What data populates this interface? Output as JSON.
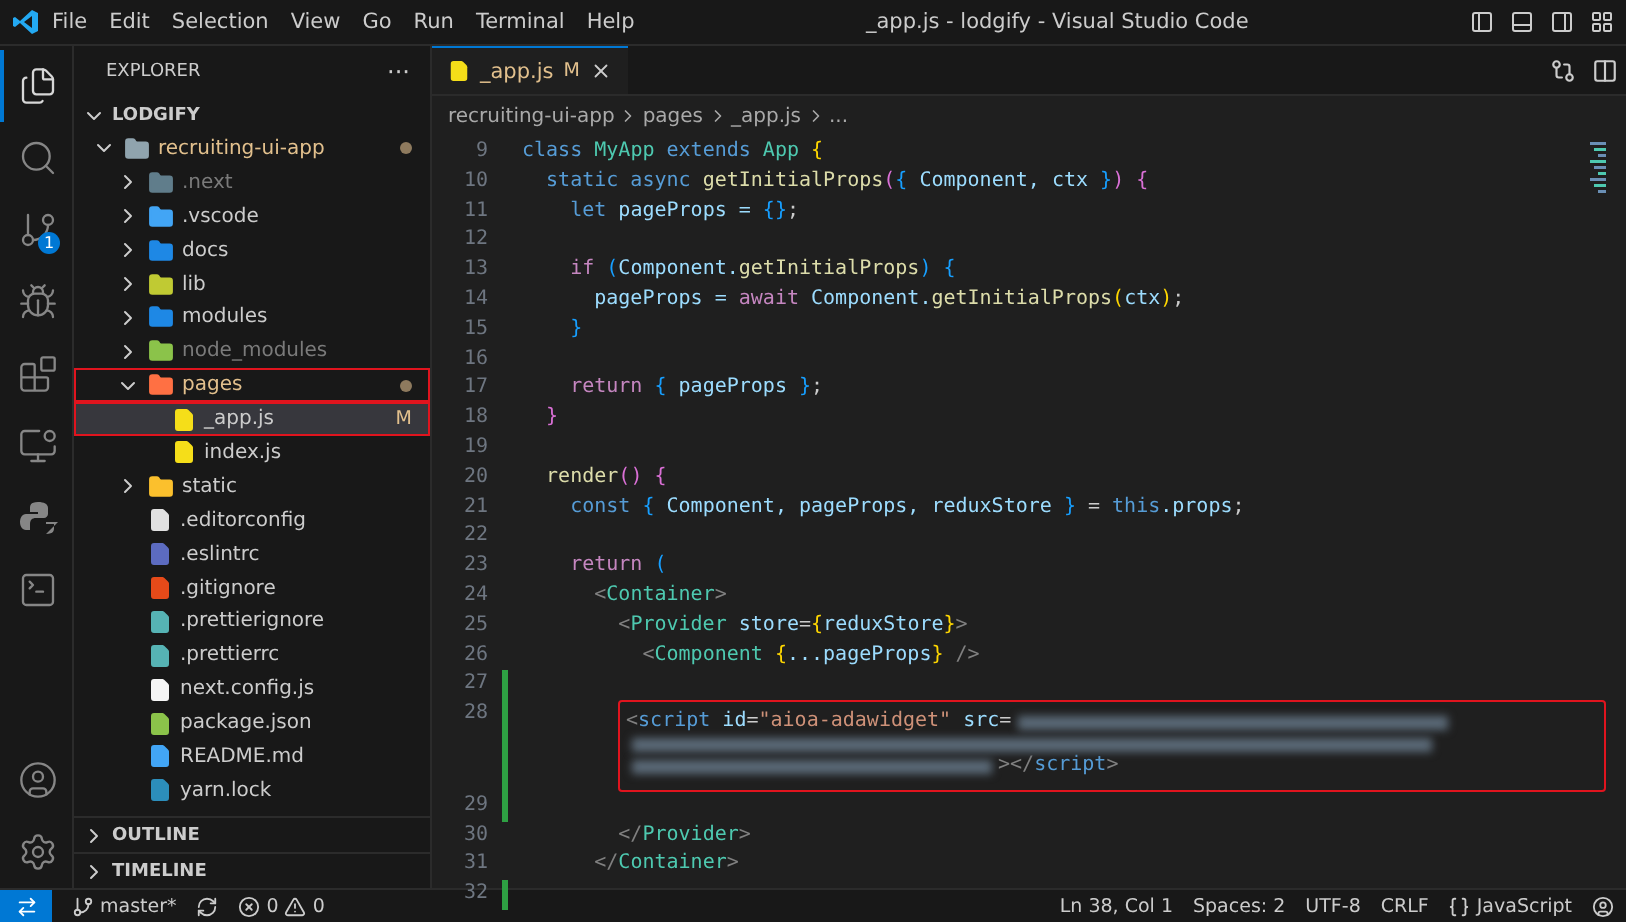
{
  "title_bar": {
    "menu": [
      "File",
      "Edit",
      "Selection",
      "View",
      "Go",
      "Run",
      "Terminal",
      "Help"
    ],
    "title": "_app.js - lodgify - Visual Studio Code"
  },
  "activity_bar": {
    "items": [
      {
        "kind": "files",
        "selected": true
      },
      {
        "kind": "search",
        "selected": false
      },
      {
        "kind": "source-control",
        "selected": false,
        "badge": "1"
      },
      {
        "kind": "debug",
        "selected": false
      },
      {
        "kind": "extensions",
        "selected": false
      },
      {
        "kind": "remote",
        "selected": false
      },
      {
        "kind": "python",
        "selected": false
      },
      {
        "kind": "terminal",
        "selected": false
      }
    ],
    "bottom": [
      {
        "kind": "account"
      },
      {
        "kind": "settings"
      }
    ]
  },
  "sidebar": {
    "title": "EXPLORER",
    "more": "···",
    "workspace": {
      "label": "LODGIFY",
      "expanded": true
    },
    "tree": [
      {
        "label": "recruiting-ui-app",
        "kind": "folder",
        "color": "#90a4ae",
        "expanded": true,
        "modified": true,
        "highlighted": false,
        "selected": false,
        "dimmed": false,
        "children": [
          {
            "label": ".next",
            "kind": "folder",
            "color": "#607d8b",
            "expanded": false,
            "modified": false,
            "highlighted": false,
            "selected": false,
            "dimmed": true
          },
          {
            "label": ".vscode",
            "kind": "folder",
            "color": "#42a5f5",
            "expanded": false,
            "modified": false,
            "highlighted": false,
            "selected": false,
            "dimmed": false
          },
          {
            "label": "docs",
            "kind": "folder",
            "color": "#1e88e5",
            "expanded": false,
            "modified": false,
            "highlighted": false,
            "selected": false,
            "dimmed": false
          },
          {
            "label": "lib",
            "kind": "folder",
            "color": "#c0ca33",
            "expanded": false,
            "modified": false,
            "highlighted": false,
            "selected": false,
            "dimmed": false
          },
          {
            "label": "modules",
            "kind": "folder",
            "color": "#1e88e5",
            "expanded": false,
            "modified": false,
            "highlighted": false,
            "selected": false,
            "dimmed": false
          },
          {
            "label": "node_modules",
            "kind": "folder",
            "color": "#8bc34a",
            "expanded": false,
            "modified": false,
            "highlighted": false,
            "selected": false,
            "dimmed": true
          },
          {
            "label": "pages",
            "kind": "folder",
            "color": "#ff7043",
            "expanded": true,
            "modified": true,
            "highlighted": true,
            "selected": false,
            "dimmed": false,
            "children": [
              {
                "label": "_app.js",
                "kind": "file",
                "color": "#f5de19",
                "badge": "M",
                "modified": false,
                "highlighted": true,
                "selected": true,
                "dimmed": false
              },
              {
                "label": "index.js",
                "kind": "file",
                "color": "#f5de19",
                "modified": false,
                "highlighted": false,
                "selected": false,
                "dimmed": false
              }
            ]
          },
          {
            "label": "static",
            "kind": "folder",
            "color": "#fbc02d",
            "expanded": false,
            "modified": false,
            "highlighted": false,
            "selected": false,
            "dimmed": false
          },
          {
            "label": ".editorconfig",
            "kind": "file",
            "color": "#e0e0e0",
            "modified": false,
            "highlighted": false,
            "selected": false,
            "dimmed": false
          },
          {
            "label": ".eslintrc",
            "kind": "file",
            "color": "#5c6bc0",
            "modified": false,
            "highlighted": false,
            "selected": false,
            "dimmed": false
          },
          {
            "label": ".gitignore",
            "kind": "file",
            "color": "#e64a19",
            "modified": false,
            "highlighted": false,
            "selected": false,
            "dimmed": false
          },
          {
            "label": ".prettierignore",
            "kind": "file",
            "color": "#56b3b4",
            "modified": false,
            "highlighted": false,
            "selected": false,
            "dimmed": false
          },
          {
            "label": ".prettierrc",
            "kind": "file",
            "color": "#56b3b4",
            "modified": false,
            "highlighted": false,
            "selected": false,
            "dimmed": false
          },
          {
            "label": "next.config.js",
            "kind": "file",
            "color": "#f5f5f5",
            "modified": false,
            "highlighted": false,
            "selected": false,
            "dimmed": false
          },
          {
            "label": "package.json",
            "kind": "file",
            "color": "#8bc34a",
            "modified": false,
            "highlighted": false,
            "selected": false,
            "dimmed": false
          },
          {
            "label": "README.md",
            "kind": "file",
            "color": "#42a5f5",
            "modified": false,
            "highlighted": false,
            "selected": false,
            "dimmed": false
          },
          {
            "label": "yarn.lock",
            "kind": "file",
            "color": "#2c8ebb",
            "modified": false,
            "highlighted": false,
            "selected": false,
            "dimmed": false
          }
        ]
      }
    ],
    "sections": [
      {
        "label": "OUTLINE",
        "expanded": false
      },
      {
        "label": "TIMELINE",
        "expanded": false
      }
    ]
  },
  "tabs": [
    {
      "label": "_app.js",
      "badge": "M",
      "selected": true
    }
  ],
  "breadcrumb": [
    "recruiting-ui-app",
    "pages",
    "_app.js",
    "..."
  ],
  "code": [
    {
      "n": "9",
      "modified": false,
      "tokens": [
        {
          "text": "class",
          "kind": "kw"
        },
        {
          "text": " MyApp",
          "kind": "cls"
        },
        {
          "text": " extends",
          "kind": "kw"
        },
        {
          "text": " App",
          "kind": "cls"
        },
        {
          "text": " {",
          "kind": "b1"
        }
      ]
    },
    {
      "n": "10",
      "modified": false,
      "tokens": [
        {
          "text": "  static async",
          "kind": "kw"
        },
        {
          "text": " getInitialProps",
          "kind": "fn"
        },
        {
          "text": "(",
          "kind": "b2"
        },
        {
          "text": "{",
          "kind": "b3"
        },
        {
          "text": " Component,",
          "kind": "var"
        },
        {
          "text": " ctx",
          "kind": "var"
        },
        {
          "text": " }",
          "kind": "b3"
        },
        {
          "text": ")",
          "kind": "b2"
        },
        {
          "text": " {",
          "kind": "b2"
        }
      ]
    },
    {
      "n": "11",
      "modified": false,
      "tokens": [
        {
          "text": "    let",
          "kind": "kw"
        },
        {
          "text": " pageProps =",
          "kind": "var"
        },
        {
          "text": " {}",
          "kind": "b3"
        },
        {
          "text": ";",
          "kind": "p"
        }
      ]
    },
    {
      "n": "12",
      "modified": false
    },
    {
      "n": "13",
      "modified": false,
      "tokens": [
        {
          "text": "    if",
          "kind": "ctl"
        },
        {
          "text": " (",
          "kind": "b3"
        },
        {
          "text": "Component.",
          "kind": "var"
        },
        {
          "text": "getInitialProps",
          "kind": "fn"
        },
        {
          "text": ")",
          "kind": "b3"
        },
        {
          "text": " {",
          "kind": "b3"
        }
      ]
    },
    {
      "n": "14",
      "modified": false,
      "tokens": [
        {
          "text": "      pageProps =",
          "kind": "var"
        },
        {
          "text": " await",
          "kind": "ctl"
        },
        {
          "text": " Component.",
          "kind": "var"
        },
        {
          "text": "getInitialProps",
          "kind": "fn"
        },
        {
          "text": "(",
          "kind": "b1"
        },
        {
          "text": "ctx",
          "kind": "var"
        },
        {
          "text": ")",
          "kind": "b1"
        },
        {
          "text": ";",
          "kind": "p"
        }
      ]
    },
    {
      "n": "15",
      "modified": false,
      "tokens": [
        {
          "text": "    }",
          "kind": "b3"
        }
      ]
    },
    {
      "n": "16",
      "modified": false
    },
    {
      "n": "17",
      "modified": false,
      "tokens": [
        {
          "text": "    return",
          "kind": "ctl"
        },
        {
          "text": " {",
          "kind": "b3"
        },
        {
          "text": " pageProps",
          "kind": "var"
        },
        {
          "text": " }",
          "kind": "b3"
        },
        {
          "text": ";",
          "kind": "p"
        }
      ]
    },
    {
      "n": "18",
      "modified": false,
      "tokens": [
        {
          "text": "  }",
          "kind": "b2"
        }
      ]
    },
    {
      "n": "19",
      "modified": false
    },
    {
      "n": "20",
      "modified": false,
      "tokens": [
        {
          "text": "  render",
          "kind": "fn"
        },
        {
          "text": "()",
          "kind": "b2"
        },
        {
          "text": " {",
          "kind": "b2"
        }
      ]
    },
    {
      "n": "21",
      "modified": false,
      "tokens": [
        {
          "text": "    const",
          "kind": "kw"
        },
        {
          "text": " {",
          "kind": "b3"
        },
        {
          "text": " Component, pageProps, reduxStore",
          "kind": "var"
        },
        {
          "text": " }",
          "kind": "b3"
        },
        {
          "text": " =",
          "kind": "p"
        },
        {
          "text": " this",
          "kind": "kw"
        },
        {
          "text": ".props",
          "kind": "var"
        },
        {
          "text": ";",
          "kind": "p"
        }
      ]
    },
    {
      "n": "22",
      "modified": false
    },
    {
      "n": "23",
      "modified": false,
      "tokens": [
        {
          "text": "    return",
          "kind": "ctl"
        },
        {
          "text": " (",
          "kind": "b3"
        }
      ]
    },
    {
      "n": "24",
      "modified": false,
      "tokens": [
        {
          "text": "      <",
          "kind": "tag"
        },
        {
          "text": "Container",
          "kind": "cls"
        },
        {
          "text": ">",
          "kind": "tag"
        }
      ]
    },
    {
      "n": "25",
      "modified": false,
      "tokens": [
        {
          "text": "        <",
          "kind": "tag"
        },
        {
          "text": "Provider",
          "kind": "cls"
        },
        {
          "text": " store",
          "kind": "var"
        },
        {
          "text": "=",
          "kind": "p"
        },
        {
          "text": "{",
          "kind": "b1"
        },
        {
          "text": "reduxStore",
          "kind": "var"
        },
        {
          "text": "}",
          "kind": "b1"
        },
        {
          "text": ">",
          "kind": "tag"
        }
      ]
    },
    {
      "n": "26",
      "modified": false,
      "tokens": [
        {
          "text": "          <",
          "kind": "tag"
        },
        {
          "text": "Component",
          "kind": "cls"
        },
        {
          "text": " {",
          "kind": "b1"
        },
        {
          "text": "...pageProps",
          "kind": "var"
        },
        {
          "text": "}",
          "kind": "b1"
        },
        {
          "text": " />",
          "kind": "tag"
        }
      ]
    },
    {
      "n": "27",
      "modified": true
    },
    {
      "n": "28",
      "modified": true,
      "kind": "boxed",
      "redacted": true,
      "tokens": [
        {
          "text": "<",
          "kind": "tag"
        },
        {
          "text": "script",
          "kind": "kw"
        },
        {
          "text": " id",
          "kind": "var"
        },
        {
          "text": "=",
          "kind": "p"
        },
        {
          "text": "\"aioa-adawidget\"",
          "kind": "str"
        },
        {
          "text": " src",
          "kind": "var"
        },
        {
          "text": "=",
          "kind": "p"
        }
      ],
      "tail": [
        {
          "text": "></",
          "kind": "tag"
        },
        {
          "text": "script",
          "kind": "kw"
        },
        {
          "text": ">",
          "kind": "tag"
        }
      ]
    },
    {
      "n": "29",
      "modified": true
    },
    {
      "n": "30",
      "modified": false,
      "tokens": [
        {
          "text": "        </",
          "kind": "tag"
        },
        {
          "text": "Provider",
          "kind": "cls"
        },
        {
          "text": ">",
          "kind": "tag"
        }
      ]
    },
    {
      "n": "31",
      "modified": false,
      "tokens": [
        {
          "text": "      </",
          "kind": "tag"
        },
        {
          "text": "Container",
          "kind": "cls"
        },
        {
          "text": ">",
          "kind": "tag"
        }
      ]
    },
    {
      "n": "32",
      "modified": true
    }
  ],
  "status_bar": {
    "branch": "master*",
    "errors": "0",
    "warnings": "0",
    "right": [
      "Ln 38, Col 1",
      "Spaces: 2",
      "UTF-8",
      "CRLF"
    ],
    "language": "JavaScript"
  }
}
